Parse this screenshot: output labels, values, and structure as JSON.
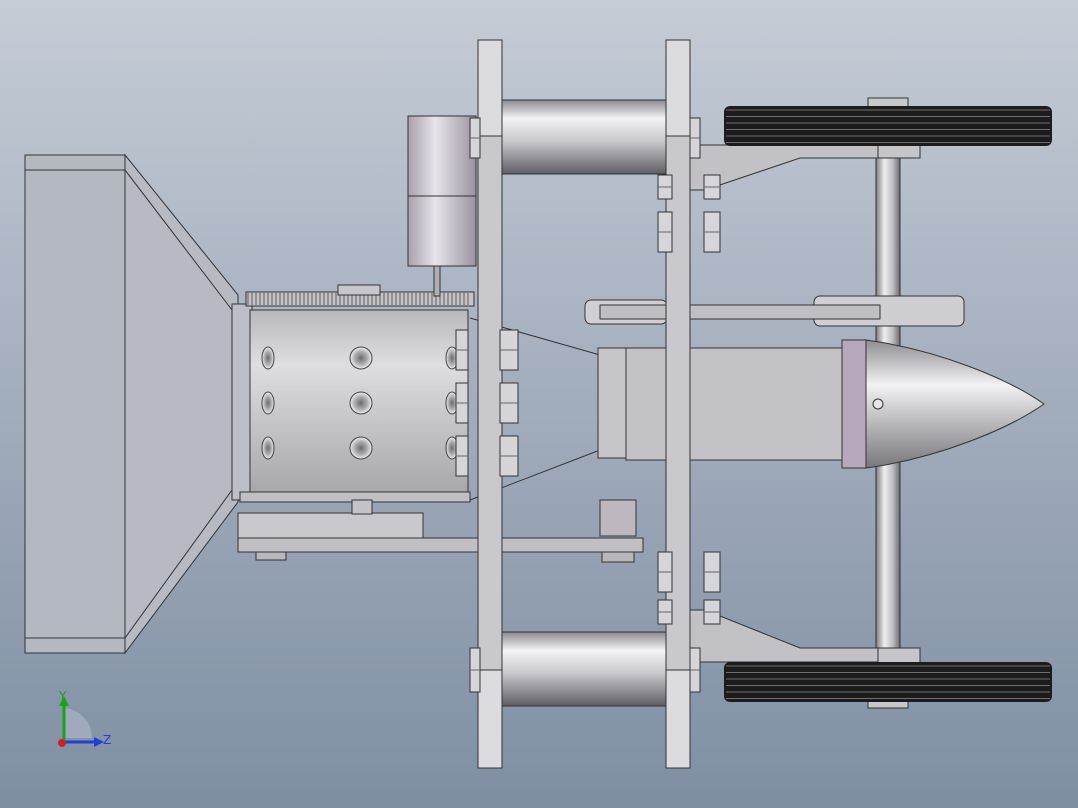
{
  "view": {
    "background_top": "#c5ccd6",
    "background_bottom": "#7f8ea3"
  },
  "triad": {
    "y_label": "Y",
    "z_label": "Z",
    "y_color": "#1aa31a",
    "z_color": "#2040d0",
    "x_color": "#d02020"
  },
  "model": {
    "plate_color": "#c8c8cc",
    "edge_color": "#2a2a2a",
    "tire_color": "#1a1a1a",
    "cone_color": "#d8d8dc"
  }
}
